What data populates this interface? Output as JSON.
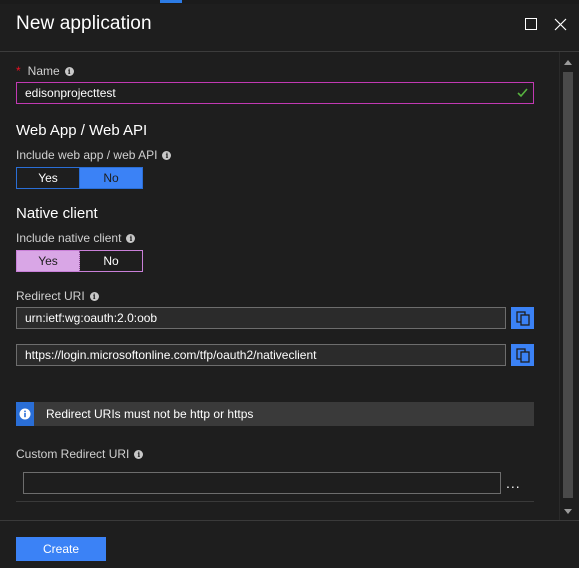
{
  "blade": {
    "title": "New application"
  },
  "form": {
    "name": {
      "required_mark": "*",
      "label": "Name",
      "value": "edisonprojecttest"
    },
    "web_app": {
      "heading": "Web App / Web API",
      "label": "Include web app / web API",
      "yes_label": "Yes",
      "no_label": "No",
      "selected": "No"
    },
    "native_client": {
      "heading": "Native client",
      "label": "Include native client",
      "yes_label": "Yes",
      "no_label": "No",
      "selected": "Yes"
    },
    "redirect_uri": {
      "label": "Redirect URI",
      "values": [
        "urn:ietf:wg:oauth:2.0:oob",
        "https://login.microsoftonline.com/tfp/oauth2/nativeclient"
      ]
    },
    "info_message": "Redirect URIs must not be http or https",
    "custom_redirect_uri": {
      "label": "Custom Redirect URI",
      "value": "",
      "more_label": "..."
    }
  },
  "footer": {
    "create_label": "Create"
  },
  "colors": {
    "accent": "#3b82f6",
    "error_mark": "#e81123",
    "success_check": "#57b33f",
    "focus_border": "#c239b3"
  },
  "icons": {
    "restore": "restore-window-icon",
    "close": "close-icon",
    "info": "info-icon",
    "copy": "copy-icon",
    "check": "checkmark-icon"
  }
}
